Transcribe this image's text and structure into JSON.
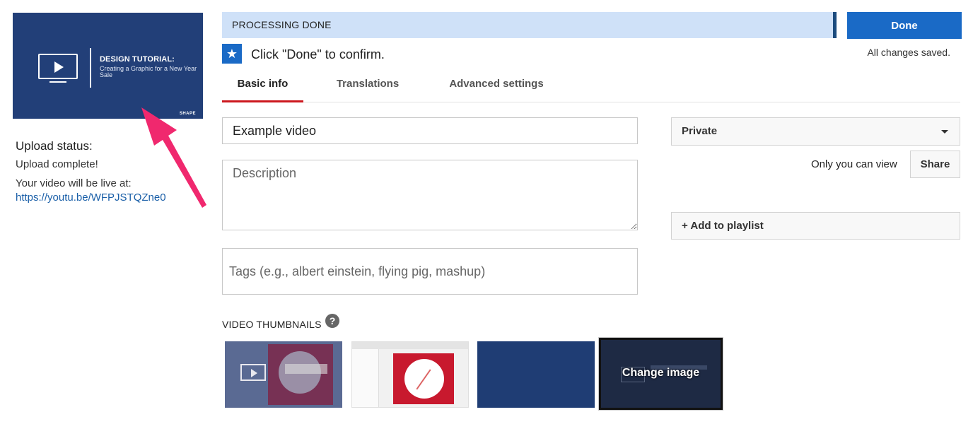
{
  "preview": {
    "title": "DESIGN TUTORIAL:",
    "subtitle": "Creating a Graphic for a New Year Sale",
    "brand": "SHAPE"
  },
  "upload": {
    "status_heading": "Upload status:",
    "status_text": "Upload complete!",
    "live_label": "Your video will be live at:",
    "live_url": "https://youtu.be/WFPJSTQZne0"
  },
  "processing": {
    "status": "PROCESSING DONE",
    "done_label": "Done",
    "saved_text": "All changes saved.",
    "confirm_text": "Click \"Done\" to confirm."
  },
  "tabs": [
    {
      "label": "Basic info",
      "active": true
    },
    {
      "label": "Translations",
      "active": false
    },
    {
      "label": "Advanced settings",
      "active": false
    }
  ],
  "form": {
    "title_value": "Example video",
    "description_placeholder": "Description",
    "tags_placeholder": "Tags (e.g., albert einstein, flying pig, mashup)"
  },
  "right_panel": {
    "privacy_value": "Private",
    "visibility_text": "Only you can view",
    "share_label": "Share",
    "playlist_label": "+ Add to playlist"
  },
  "thumbnails": {
    "heading": "VIDEO THUMBNAILS",
    "help_glyph": "?",
    "change_label": "Change image"
  },
  "colors": {
    "accent": "#1a6ac6",
    "processing_bg": "#cfe1f8",
    "tab_active": "#cc181e",
    "annotation_arrow": "#f0286e"
  },
  "icons": {
    "star": "★"
  }
}
